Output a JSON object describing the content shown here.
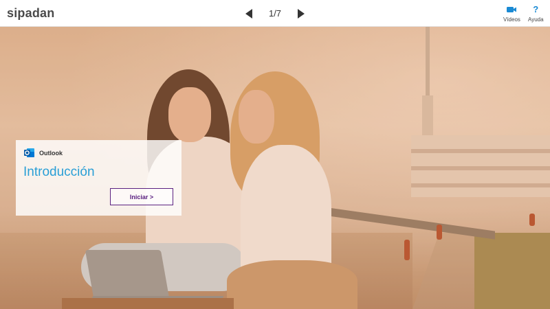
{
  "app": {
    "logo_text": "sipadan"
  },
  "pager": {
    "current": "1/7",
    "prev_icon": "triangle-left-icon",
    "next_icon": "triangle-right-icon"
  },
  "actions": {
    "videos": {
      "label": "Vídeos",
      "icon": "video-camera-icon",
      "color": "#1a8ad4"
    },
    "help": {
      "label": "Ayuda",
      "icon_text": "?",
      "color": "#1a8ad4"
    }
  },
  "card": {
    "app_name": "Outlook",
    "app_icon": "outlook-icon",
    "title": "Introducción",
    "start_label": "Iniciar >",
    "accent_color": "#2a9fd6",
    "button_color": "#5a2080"
  },
  "hero": {
    "image": "two-women-laptop-riverside-photo"
  }
}
